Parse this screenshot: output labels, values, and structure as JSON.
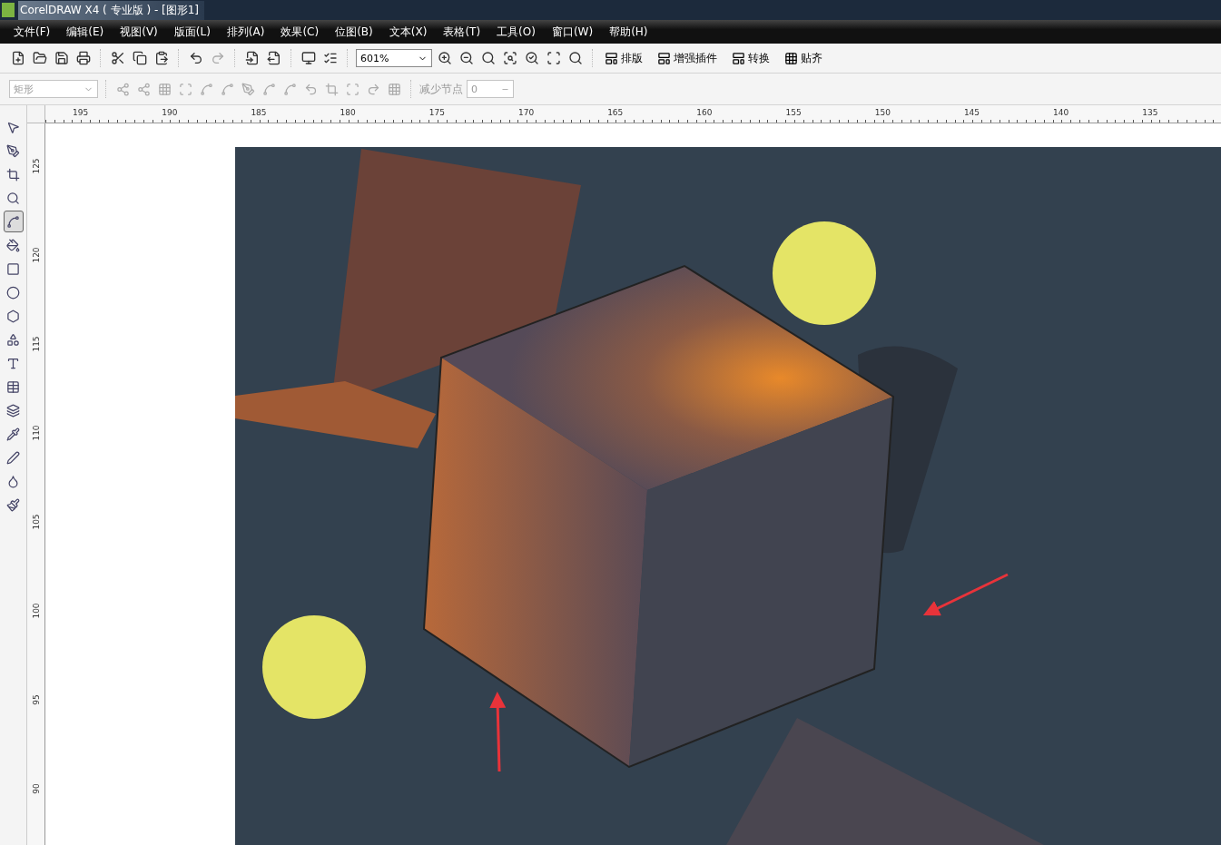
{
  "window": {
    "title": "CorelDRAW X4 ( 专业版 ) - [图形1]"
  },
  "menu": [
    "文件(F)",
    "编辑(E)",
    "视图(V)",
    "版面(L)",
    "排列(A)",
    "效果(C)",
    "位图(B)",
    "文本(X)",
    "表格(T)",
    "工具(O)",
    "窗口(W)",
    "帮助(H)"
  ],
  "standard_toolbar": {
    "icons": [
      {
        "kind": "new"
      },
      {
        "kind": "open"
      },
      {
        "kind": "save"
      },
      {
        "kind": "print"
      },
      {
        "kind": "sep"
      },
      {
        "kind": "cut"
      },
      {
        "kind": "copy"
      },
      {
        "kind": "paste"
      },
      {
        "kind": "sep"
      },
      {
        "kind": "undo"
      },
      {
        "kind": "redo"
      },
      {
        "kind": "sep"
      },
      {
        "kind": "import"
      },
      {
        "kind": "export"
      },
      {
        "kind": "sep"
      },
      {
        "kind": "launcher"
      },
      {
        "kind": "options"
      }
    ],
    "zoom": "601%",
    "zoom_icons": [
      {
        "kind": "zoom-in"
      },
      {
        "kind": "zoom-out"
      },
      {
        "kind": "zoom-selected"
      },
      {
        "kind": "zoom-all"
      },
      {
        "kind": "zoom-page"
      },
      {
        "kind": "zoom-width"
      },
      {
        "kind": "zoom-height"
      }
    ],
    "buttons": [
      "排版",
      "增强插件",
      "转换",
      "贴齐"
    ]
  },
  "property_bar": {
    "shape": "矩形",
    "reduce_label": "减少节点",
    "reduce_value": "0"
  },
  "ruler_h": [
    "195",
    "190",
    "185",
    "180",
    "175",
    "170",
    "165",
    "160",
    "155",
    "150",
    "145",
    "140",
    "135"
  ],
  "ruler_v": [
    "125",
    "120",
    "115",
    "110",
    "105",
    "100",
    "95",
    "90"
  ],
  "tools": [
    {
      "kind": "pick",
      "selected": false
    },
    {
      "kind": "freehand",
      "selected": false
    },
    {
      "kind": "crop",
      "selected": false
    },
    {
      "kind": "zoom",
      "selected": false
    },
    {
      "kind": "node",
      "selected": true
    },
    {
      "kind": "fill-smart",
      "selected": false
    },
    {
      "kind": "rect",
      "selected": false
    },
    {
      "kind": "ellipse",
      "selected": false
    },
    {
      "kind": "polygon",
      "selected": false
    },
    {
      "kind": "shapes",
      "selected": false
    },
    {
      "kind": "text",
      "selected": false
    },
    {
      "kind": "table",
      "selected": false
    },
    {
      "kind": "blend",
      "selected": false
    },
    {
      "kind": "eyedropper",
      "selected": false
    },
    {
      "kind": "outline",
      "selected": false
    },
    {
      "kind": "fill",
      "selected": false
    },
    {
      "kind": "interactive-fill",
      "selected": false
    }
  ]
}
